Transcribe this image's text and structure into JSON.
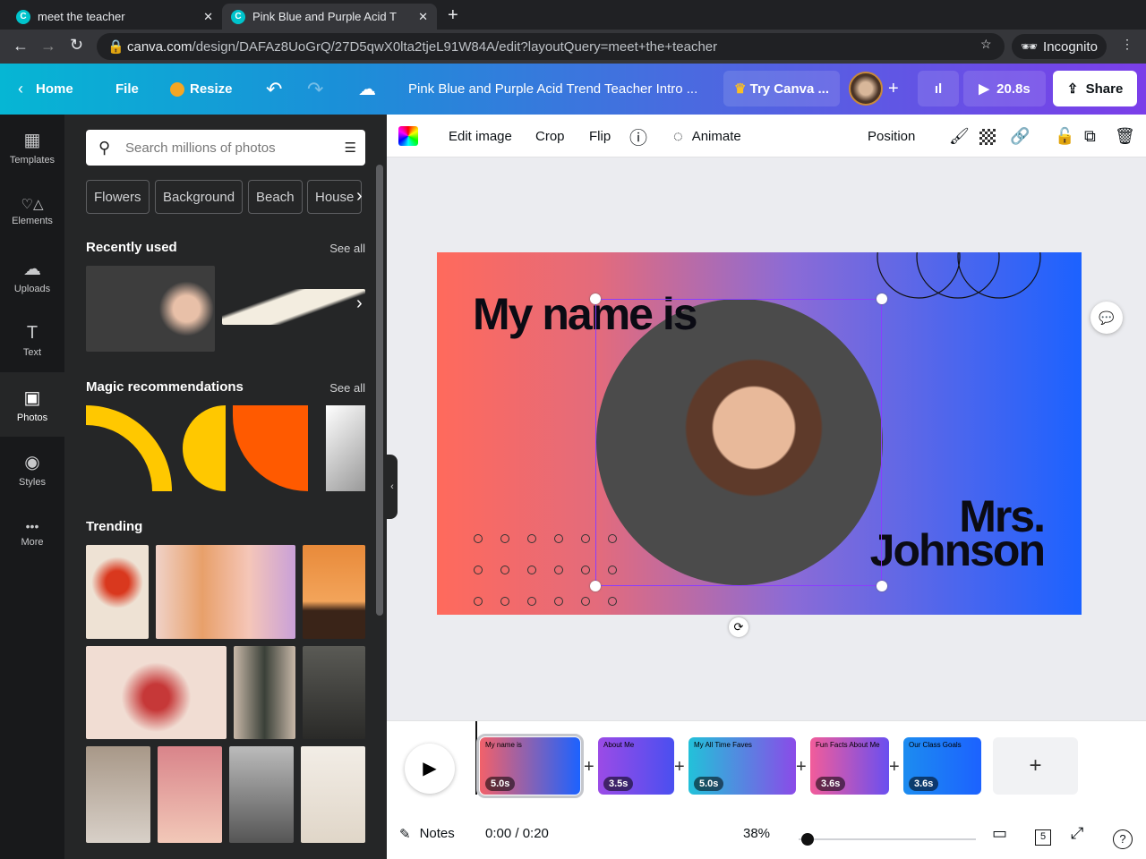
{
  "browser": {
    "tabs": [
      {
        "title": "meet the teacher"
      },
      {
        "title": "Pink Blue and Purple Acid T"
      }
    ],
    "url_host": "canva.com",
    "url_path": "/design/DAFAz8UoGrQ/27D5qwX0lta2tjeL91W84A/edit?layoutQuery=meet+the+teacher",
    "profile": "Incognito"
  },
  "header": {
    "home": "Home",
    "file": "File",
    "resize": "Resize",
    "title": "Pink Blue and Purple Acid Trend Teacher Intro ...",
    "try": "Try Canva ...",
    "play": "20.8s",
    "share": "Share"
  },
  "rail": [
    {
      "label": "Templates",
      "icon": "▦"
    },
    {
      "label": "Elements",
      "icon": "♡△"
    },
    {
      "label": "Uploads",
      "icon": "☁"
    },
    {
      "label": "Text",
      "icon": "T"
    },
    {
      "label": "Photos",
      "icon": "▣"
    },
    {
      "label": "Styles",
      "icon": "◉"
    },
    {
      "label": "More",
      "icon": "•••"
    }
  ],
  "panel": {
    "search_placeholder": "Search millions of photos",
    "chips": [
      "Flowers",
      "Background",
      "Beach",
      "House"
    ],
    "recent": "Recently used",
    "magic": "Magic recommendations",
    "trending": "Trending",
    "see_all": "See all"
  },
  "toolbar": {
    "edit": "Edit image",
    "crop": "Crop",
    "flip": "Flip",
    "animate": "Animate",
    "position": "Position"
  },
  "slide": {
    "heading": "My name is",
    "name1": "Mrs.",
    "name2": "Johnson"
  },
  "timeline": [
    {
      "title": "My name is",
      "dur": "5.0s"
    },
    {
      "title": "About Me",
      "dur": "3.5s"
    },
    {
      "title": "My All Time Faves",
      "dur": "5.0s"
    },
    {
      "title": "Fun Facts About Me",
      "dur": "3.6s"
    },
    {
      "title": "Our Class Goals",
      "dur": "3.6s"
    }
  ],
  "bottom": {
    "notes": "Notes",
    "time": "0:00 / 0:20",
    "zoom": "38%",
    "pages": "5"
  },
  "colors": {
    "accent": "#8b3dff"
  }
}
